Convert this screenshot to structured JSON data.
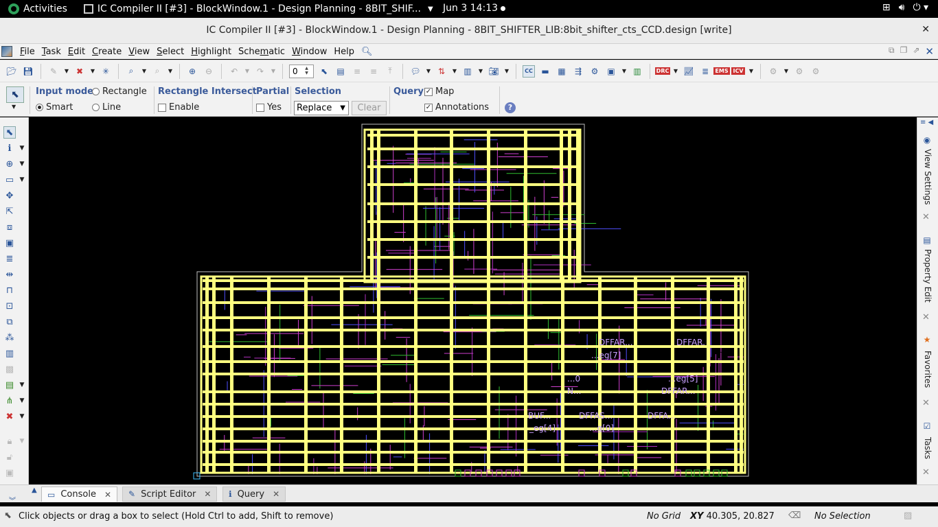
{
  "topbar": {
    "activities": "Activities",
    "app_title": "IC Compiler II [#3] - BlockWindow.1 - Design Planning - 8BIT_SHIF...",
    "clock": "Jun 3  14:13"
  },
  "window": {
    "title": "IC Compiler II [#3] - BlockWindow.1 - Design Planning - 8BIT_SHIFTER_LIB:8bit_shifter_cts_CCD.design [write]"
  },
  "menu": {
    "items": [
      {
        "pre": "",
        "ul": "F",
        "post": "ile"
      },
      {
        "pre": "",
        "ul": "T",
        "post": "ask"
      },
      {
        "pre": "",
        "ul": "E",
        "post": "dit"
      },
      {
        "pre": "",
        "ul": "C",
        "post": "reate"
      },
      {
        "pre": "",
        "ul": "V",
        "post": "iew"
      },
      {
        "pre": "",
        "ul": "S",
        "post": "elect"
      },
      {
        "pre": "",
        "ul": "H",
        "post": "ighlight"
      },
      {
        "pre": "Sche",
        "ul": "m",
        "post": "atic"
      },
      {
        "pre": "",
        "ul": "W",
        "post": "indow"
      },
      {
        "pre": "",
        "ul": "",
        "post": "Help"
      }
    ]
  },
  "toolbar": {
    "layer_spin_value": "0"
  },
  "options": {
    "input_mode_label": "Input mode",
    "rectangle": "Rectangle",
    "smart": "Smart",
    "line": "Line",
    "rect_intersect_label": "Rectangle Intersect",
    "enable": "Enable",
    "partial_label": "Partial",
    "yes": "Yes",
    "selection_label": "Selection",
    "selection_value": "Replace",
    "clear": "Clear",
    "query_label": "Query",
    "map": "Map",
    "annotations": "Annotations",
    "help_glyph": "?"
  },
  "canvas": {
    "labels": [
      "DFFAR...",
      "DFFAR.",
      "...eg[7]",
      "...0",
      "...eg[5]",
      "N...",
      "DFFAR...",
      "BUF...",
      "DFFAS...",
      "DFFA...",
      "_eg[4]",
      "...g[0]"
    ]
  },
  "right_dock": {
    "view_settings": "View Settings",
    "property_editor": "Property Edit",
    "favorites": "Favorites",
    "tasks": "Tasks"
  },
  "tabs": {
    "console": "Console",
    "script_editor": "Script Editor",
    "query": "Query"
  },
  "status": {
    "message": "Click objects or drag a box to select (Hold Ctrl to add, Shift to remove)",
    "grid": "No Grid",
    "xy_label": "XY",
    "xy_value": "40.305, 20.827",
    "selection": "No Selection"
  }
}
